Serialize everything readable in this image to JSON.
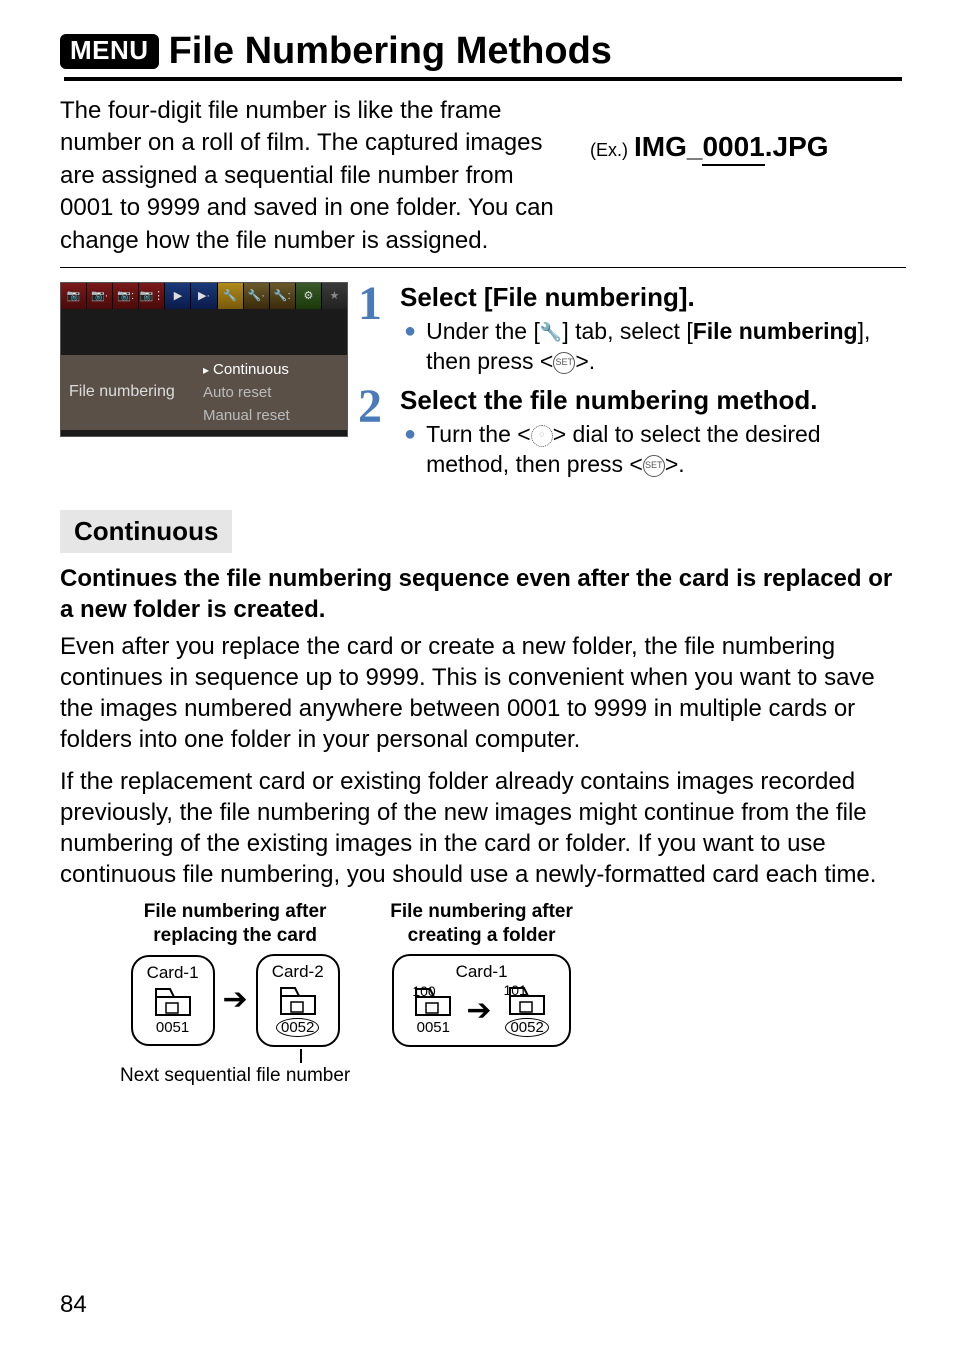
{
  "header": {
    "menu_badge": "MENU",
    "title": "File Numbering Methods"
  },
  "intro": "The four-digit file number is like the frame number on a roll of film. The captured images are assigned a sequential file number from 0001 to 9999 and saved in one folder. You can change how the file number is assigned.",
  "example": {
    "label": "(Ex.)",
    "prefix": "IMG_",
    "num": "0001",
    "ext": ".JPG"
  },
  "menu_screenshot": {
    "row_label": "File numbering",
    "options": [
      "Continuous",
      "Auto reset",
      "Manual reset"
    ]
  },
  "steps": [
    {
      "num": "1",
      "title": "Select [File numbering].",
      "bullet_pre": "Under the [",
      "bullet_mid": "] tab, select [",
      "bullet_bold1": "File numbering",
      "bullet_post": "], then press <",
      "bullet_end": ">."
    },
    {
      "num": "2",
      "title": "Select the file numbering method.",
      "bullet_pre": "Turn the <",
      "bullet_mid": "> dial to select the desired method, then press <",
      "bullet_end": ">."
    }
  ],
  "continuous": {
    "label": "Continuous",
    "subhead": "Continues the file numbering sequence even after the card is replaced or a new folder is created.",
    "para1": "Even after you replace the card or create a new folder, the file numbering continues in sequence up to 9999. This is convenient when you want to save the images numbered anywhere between 0001 to 9999 in multiple cards or folders into one folder in your personal computer.",
    "para2": "If the replacement card or existing folder already contains images recorded previously, the file numbering of the new images might continue from the file numbering of the existing images in the card or folder. If you want to use continuous file numbering, you should use a newly-formatted card each time."
  },
  "diagrams": {
    "left": {
      "title_l1": "File numbering after",
      "title_l2": "replacing the card",
      "card1": "Card-1",
      "card2": "Card-2",
      "num1": "0051",
      "num2": "0052",
      "caption": "Next sequential file number"
    },
    "right": {
      "title_l1": "File numbering after",
      "title_l2": "creating a folder",
      "card": "Card-1",
      "folder1": "100",
      "folder2": "101",
      "num1": "0051",
      "num2": "0052"
    }
  },
  "page_num": "84"
}
